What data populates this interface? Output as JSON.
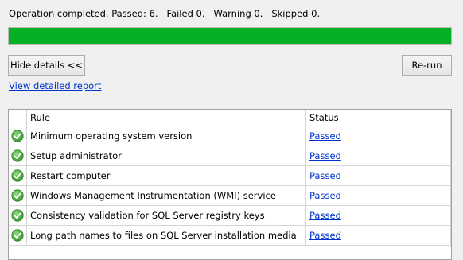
{
  "summary": {
    "text": "Operation completed. Passed: 6.   Failed 0.   Warning 0.   Skipped 0."
  },
  "progress": {
    "fraction": 1.0,
    "color": "#06b025"
  },
  "buttons": {
    "hide_details": "Hide details <<",
    "rerun": "Re-run"
  },
  "report_link": "View detailed report",
  "table": {
    "columns": [
      "",
      "Rule",
      "Status"
    ],
    "rows": [
      {
        "icon": "check-circle-icon",
        "rule": "Minimum operating system version",
        "status": "Passed"
      },
      {
        "icon": "check-circle-icon",
        "rule": "Setup administrator",
        "status": "Passed"
      },
      {
        "icon": "check-circle-icon",
        "rule": "Restart computer",
        "status": "Passed"
      },
      {
        "icon": "check-circle-icon",
        "rule": "Windows Management Instrumentation (WMI) service",
        "status": "Passed"
      },
      {
        "icon": "check-circle-icon",
        "rule": "Consistency validation for SQL Server registry keys",
        "status": "Passed"
      },
      {
        "icon": "check-circle-icon",
        "rule": "Long path names to files on SQL Server installation media",
        "status": "Passed"
      }
    ]
  },
  "colors": {
    "link": "#0033cc",
    "pass_green": "#06b025",
    "check_green": "#3a9d35"
  }
}
